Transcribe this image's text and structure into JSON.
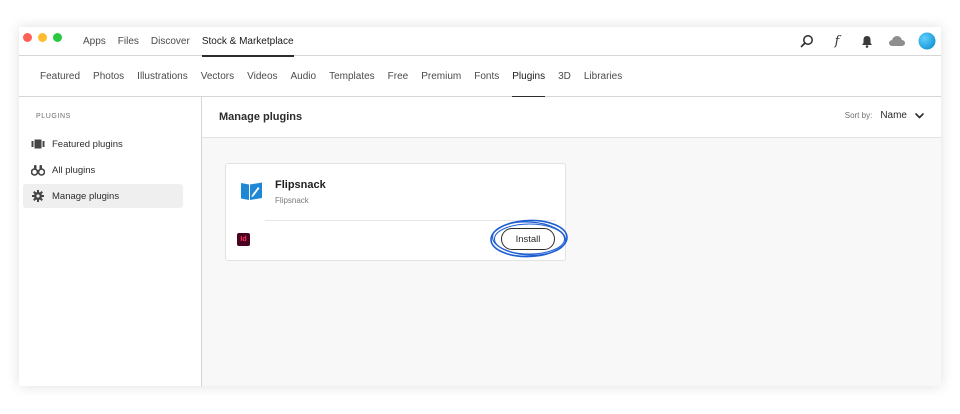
{
  "colors": {
    "traffic_red": "#ff5f57",
    "traffic_yellow": "#febc2e",
    "traffic_green": "#28c840",
    "cloud_icon": "#8e8e8e",
    "avatar": "#1aa6e0",
    "flipsnack_blue": "#1e88d6",
    "highlight_circle": "#1f5fd1",
    "indesign_badge_bg": "#49021f",
    "indesign_badge_fg": "#ff3366"
  },
  "top_nav": {
    "items": [
      "Apps",
      "Files",
      "Discover",
      "Stock & Marketplace"
    ],
    "active": "Stock & Marketplace"
  },
  "toolbar": {
    "icons": [
      "search-icon",
      "fonts-icon",
      "notifications-bell-icon",
      "creative-cloud-icon",
      "user-avatar"
    ],
    "fonts_glyph": "f"
  },
  "category_nav": {
    "items": [
      "Featured",
      "Photos",
      "Illustrations",
      "Vectors",
      "Videos",
      "Audio",
      "Templates",
      "Free",
      "Premium",
      "Fonts",
      "Plugins",
      "3D",
      "Libraries"
    ],
    "active": "Plugins"
  },
  "sidebar": {
    "heading": "PLUGINS",
    "items": [
      {
        "label": "Featured plugins",
        "icon": "featured-film-icon"
      },
      {
        "label": "All plugins",
        "icon": "binoculars-icon"
      },
      {
        "label": "Manage plugins",
        "icon": "gear-icon"
      }
    ],
    "active": "Manage plugins"
  },
  "main": {
    "title": "Manage plugins",
    "sort_label": "Sort by:",
    "sort_value": "Name"
  },
  "plugin_card": {
    "name": "Flipsnack",
    "developer": "Flipsnack",
    "app_badge": "Id",
    "install_label": "Install"
  }
}
